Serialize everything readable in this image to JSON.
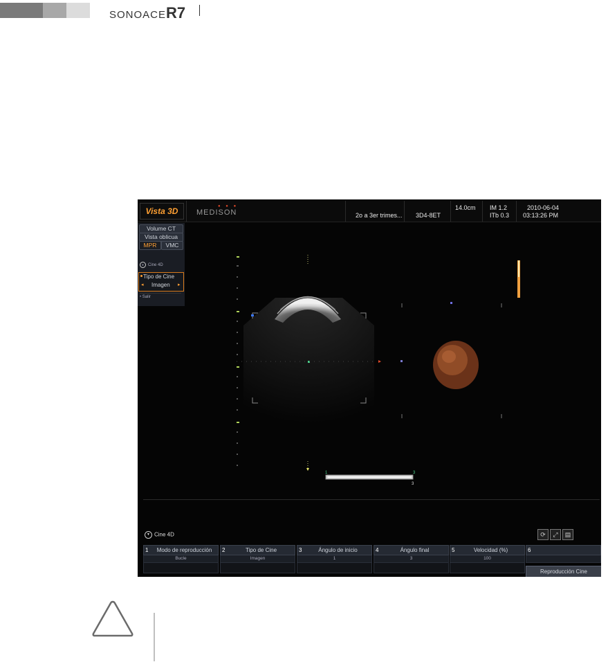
{
  "document": {
    "brand_prefix": "SONOACE",
    "brand_model": "R7"
  },
  "screen": {
    "mode_title": "Vista 3D",
    "logo": "MEDISON",
    "preset": "2o a 3er trimes...",
    "probe": "3D4-8ET",
    "depth": "14.0cm",
    "im": "IM 1.2",
    "itb": "ITb 0.3",
    "date": "2010-06-04",
    "time": "03:13:26 PM"
  },
  "left_menu": {
    "tabs": [
      "Volume CT",
      "Vista oblicua",
      "MPR",
      "VMC"
    ],
    "active_tab": "MPR",
    "cine_label": "Cine 4D",
    "cine_type_label": "Tipo de Cine",
    "cine_type_value": "Imagen",
    "exit_label": "Salir"
  },
  "viewport": {
    "slider_start": "1",
    "slider_end": "3",
    "slider_value": "3"
  },
  "bottom": {
    "cine_label": "Cine 4D",
    "controls": [
      {
        "num": "1",
        "label": "Modo de reproducción",
        "value": "Bucle"
      },
      {
        "num": "2",
        "label": "Tipo de Cine",
        "value": "Imagen"
      },
      {
        "num": "3",
        "label": "Ángulo de inicio",
        "value": "1"
      },
      {
        "num": "4",
        "label": "Ángulo final",
        "value": "3"
      },
      {
        "num": "5",
        "label": "Velocidad (%)",
        "value": "100"
      },
      {
        "num": "6",
        "label": "",
        "value": ""
      }
    ],
    "playback_button": "Reproducción Cine"
  },
  "colors": {
    "accent_orange": "#ffa033",
    "panel_bg": "#050505",
    "highlight_border": "#d87a1b"
  }
}
